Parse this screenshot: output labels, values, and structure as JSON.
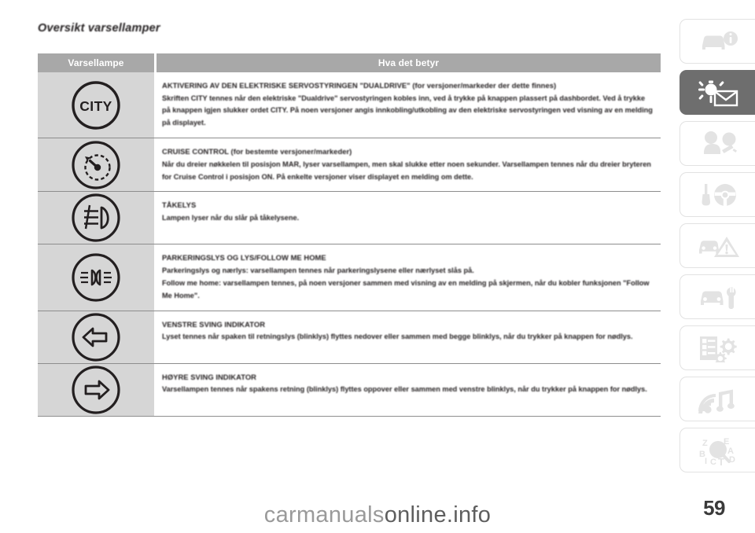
{
  "document": {
    "title": "Oversikt varsellamper",
    "page_number": "59",
    "watermark_left": "carmanuals",
    "watermark_right": "online.info"
  },
  "table": {
    "headers": {
      "lamp": "Varsellampe",
      "meaning": "Hva det betyr"
    },
    "rows": [
      {
        "icon_name": "city-steering-lamp-icon",
        "icon_label": "CITY",
        "title": "AKTIVERING AV DEN ELEKTRISKE SERVOSTYRINGEN \"DUALDRIVE\" (for versjoner/markeder der dette finnes)",
        "paragraphs": [
          "Skriften CITY tennes når den elektriske \"Dualdrive\" servostyringen kobles inn, ved å trykke på knappen plassert på dashbordet. Ved å trykke på knappen igjen slukker ordet CITY. På noen versjoner angis innkobling/utkobling av den elektriske servostyringen ved visning av en melding på displayet."
        ]
      },
      {
        "icon_name": "cruise-control-lamp-icon",
        "icon_label": "",
        "title": "CRUISE CONTROL (for bestemte versjoner/markeder)",
        "paragraphs": [
          "Når du dreier nøkkelen til posisjon MAR, lyser varsellampen, men skal slukke etter noen sekunder. Varsellampen tennes når du dreier bryteren for Cruise Control i posisjon ON. På enkelte versjoner viser displayet en melding om dette."
        ]
      },
      {
        "icon_name": "fog-lamp-icon",
        "icon_label": "",
        "title": "TÅKELYS",
        "paragraphs": [
          "Lampen lyser når du slår på tåkelysene."
        ]
      },
      {
        "icon_name": "parking-lights-follow-me-home-icon",
        "icon_label": "",
        "title": "PARKERINGSLYS OG LYS/FOLLOW ME HOME",
        "paragraphs": [
          "Parkeringslys og nærlys: varsellampen tennes når parkeringslysene eller nærlyset slås på.",
          "Follow me home: varsellampen tennes, på noen versjoner sammen med visning av en melding på skjermen, når du kobler funksjonen \"Follow Me Home\"."
        ]
      },
      {
        "icon_name": "left-turn-indicator-icon",
        "icon_label": "",
        "title": "VENSTRE SVING INDIKATOR",
        "paragraphs": [
          "Lyset tennes når spaken til retningslys (blinklys) flyttes nedover eller sammen med begge blinklys, når du trykker på knappen for nødlys."
        ]
      },
      {
        "icon_name": "right-turn-indicator-icon",
        "icon_label": "",
        "title": "HØYRE SVING INDIKATOR",
        "paragraphs": [
          "Varsellampen tennes når spakens retning (blinklys) flyttes oppover eller sammen med venstre blinklys, når du trykker på knappen for nødlys."
        ]
      }
    ]
  },
  "sidebar": {
    "tabs": [
      {
        "name": "car-info-icon",
        "active": false
      },
      {
        "name": "warning-lights-messages-icon",
        "active": true
      },
      {
        "name": "airbag-safety-icon",
        "active": false
      },
      {
        "name": "key-steering-wheel-icon",
        "active": false
      },
      {
        "name": "emergency-warning-triangle-icon",
        "active": false
      },
      {
        "name": "car-maintenance-wrench-icon",
        "active": false
      },
      {
        "name": "technical-specifications-icon",
        "active": false
      },
      {
        "name": "multimedia-audio-icon",
        "active": false
      },
      {
        "name": "alphabetical-index-icon",
        "active": false
      }
    ]
  },
  "colors": {
    "header_bg": "#a8a8a8",
    "icon_cell_bg": "#d6d6d6",
    "active_tab_bg": "#6e6e6e",
    "text": "#231f20"
  }
}
